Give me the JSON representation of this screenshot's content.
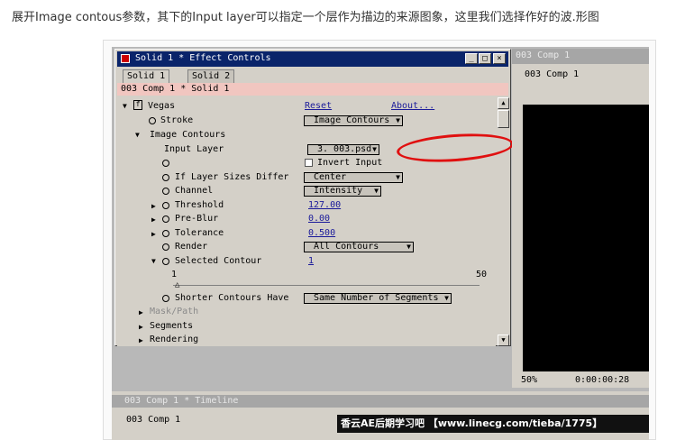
{
  "caption": "展开Image contous参数，其下的Input layer可以指定一个层作为描边的来源图象，这里我们选择作好的波.形图",
  "effect_window": {
    "title": "Solid 1 * Effect Controls",
    "tabs": [
      "Solid 1",
      "Solid 2"
    ],
    "path": "003 Comp 1 * Solid 1",
    "effect_name": "Vegas",
    "reset": "Reset",
    "about": "About...",
    "stroke_label": "Stroke",
    "stroke_value": "Image Contours",
    "image_contours": "Image Contours",
    "input_layer_label": "Input Layer",
    "input_layer_value": "3. 003.psd",
    "invert_input": "Invert Input",
    "if_sizes_label": "If Layer Sizes Differ",
    "if_sizes_value": "Center",
    "channel_label": "Channel",
    "channel_value": "Intensity",
    "threshold_label": "Threshold",
    "threshold_value": "127.00",
    "preblur_label": "Pre-Blur",
    "preblur_value": "0.00",
    "tolerance_label": "Tolerance",
    "tolerance_value": "0.500",
    "render_label": "Render",
    "render_value": "All Contours",
    "selected_label": "Selected Contour",
    "selected_value": "1",
    "slider_min": "1",
    "slider_max": "50",
    "shorter_label": "Shorter Contours Have",
    "shorter_value": "Same Number of Segments",
    "mask_path": "Mask/Path",
    "segments": "Segments",
    "rendering": "Rendering"
  },
  "comp_viewer": {
    "title": "003 Comp 1",
    "tab": "003 Comp 1",
    "zoom": "50%",
    "timecode": "0:00:00:28"
  },
  "timeline": {
    "title": "003 Comp 1 * Timeline",
    "tab": "003 Comp 1"
  },
  "watermark": "香云AE后期学习吧 【www.linecg.com/tieba/1775】"
}
